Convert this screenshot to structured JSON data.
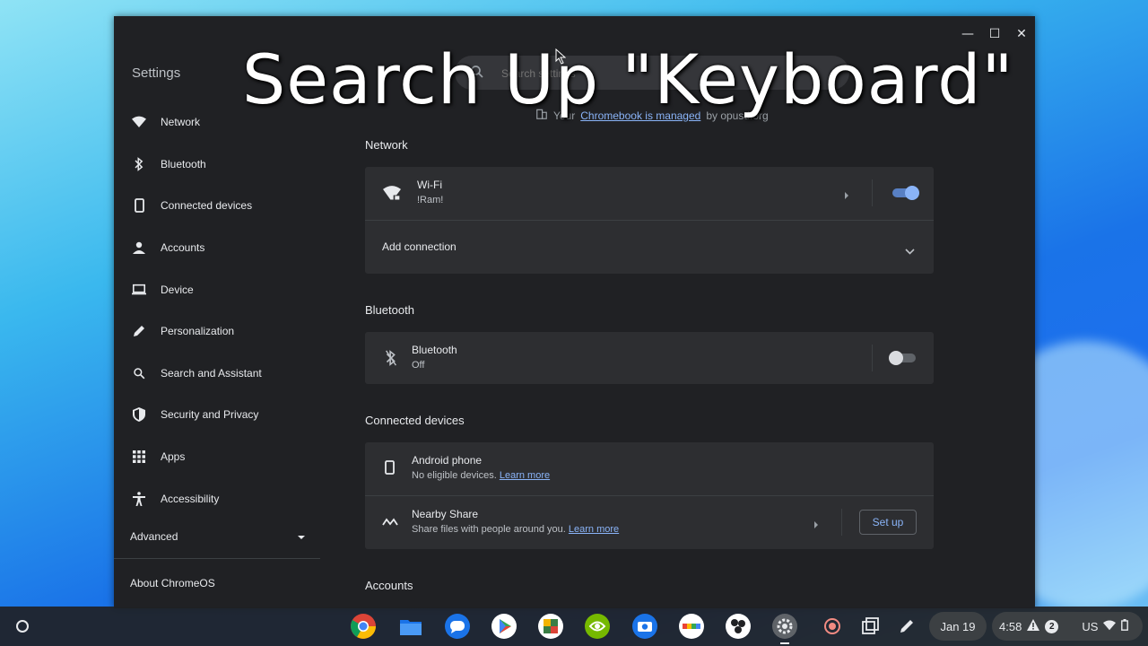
{
  "overlay": {
    "title": "Search Up \"Keyboard\""
  },
  "window": {
    "app_title": "Settings",
    "caption": {
      "minimize": "—",
      "maximize": "☐",
      "close": "✕"
    }
  },
  "search": {
    "placeholder": "Search settings"
  },
  "managed": {
    "prefix": "Your",
    "link": "Chromebook is managed",
    "suffix": "by opusd.org"
  },
  "sidebar": {
    "items": [
      {
        "label": "Network",
        "icon": "wifi-icon"
      },
      {
        "label": "Bluetooth",
        "icon": "bluetooth-icon"
      },
      {
        "label": "Connected devices",
        "icon": "phone-icon"
      },
      {
        "label": "Accounts",
        "icon": "person-icon"
      },
      {
        "label": "Device",
        "icon": "laptop-icon"
      },
      {
        "label": "Personalization",
        "icon": "pencil-icon"
      },
      {
        "label": "Search and Assistant",
        "icon": "search-icon"
      },
      {
        "label": "Security and Privacy",
        "icon": "shield-icon"
      },
      {
        "label": "Apps",
        "icon": "apps-grid-icon"
      },
      {
        "label": "Accessibility",
        "icon": "accessibility-icon"
      }
    ],
    "advanced": "Advanced",
    "about": "About ChromeOS"
  },
  "network": {
    "title": "Network",
    "wifi_label": "Wi-Fi",
    "wifi_network": "!Ram!",
    "add_connection": "Add connection"
  },
  "bluetooth": {
    "title": "Bluetooth",
    "label": "Bluetooth",
    "status": "Off"
  },
  "connected": {
    "title": "Connected devices",
    "android_label": "Android phone",
    "android_desc": "No eligible devices.",
    "android_link": "Learn more",
    "nearby_label": "Nearby Share",
    "nearby_desc": "Share files with people around you.",
    "nearby_link": "Learn more",
    "setup_button": "Set up"
  },
  "accounts": {
    "title": "Accounts"
  },
  "shelf": {
    "date": "Jan 19",
    "time": "4:58",
    "notification_count": "2",
    "locale": "US"
  },
  "colors": {
    "accent": "#8ab4f8",
    "window_bg": "#202124",
    "card_bg": "#2d2e31"
  }
}
